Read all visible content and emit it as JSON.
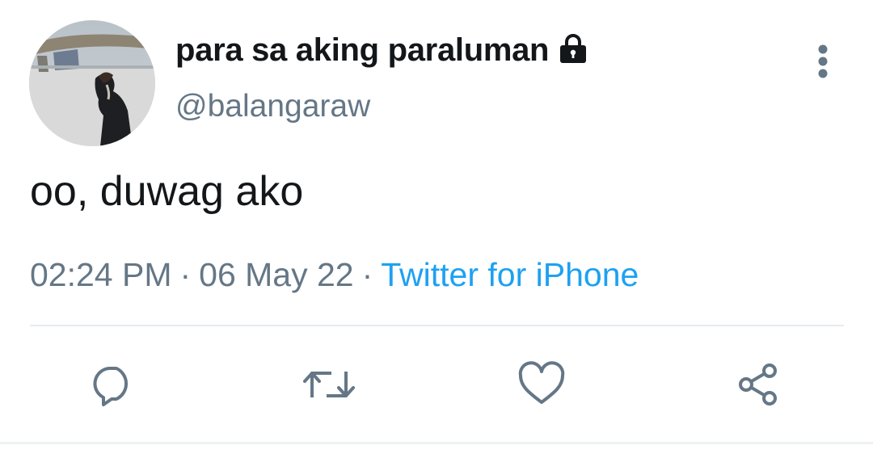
{
  "tweet": {
    "author": {
      "display_name": "para sa aking paraluman",
      "handle": "@balangaraw",
      "protected_icon": "lock-icon"
    },
    "text": "oo, duwag ako",
    "time": "02:24 PM",
    "separator": "·",
    "date": "06 May 22",
    "source": "Twitter for iPhone",
    "more_icon": "more-vertical-icon"
  },
  "actions": [
    {
      "name": "reply",
      "icon": "reply-icon"
    },
    {
      "name": "retweet",
      "icon": "retweet-icon"
    },
    {
      "name": "like",
      "icon": "heart-icon"
    },
    {
      "name": "share",
      "icon": "share-icon"
    }
  ],
  "colors": {
    "text_primary": "#14171a",
    "text_secondary": "#657786",
    "link": "#1da1f2",
    "divider": "#e6ecf0"
  }
}
